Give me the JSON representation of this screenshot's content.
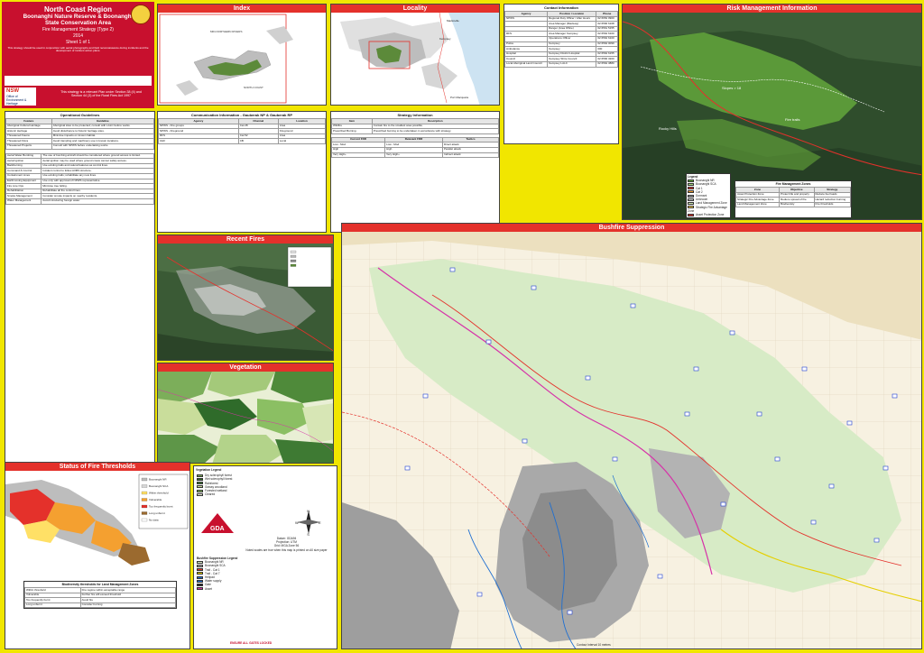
{
  "header": {
    "region": "North Coast Region",
    "reserve_line1": "Boonanghi Nature Reserve & Boonanghi",
    "reserve_line2": "State Conservation Area",
    "strategy": "Fire Management Strategy (Type 2)",
    "year": "2014",
    "sheet": "Sheet 1 of 1",
    "blurb": "This strategy should be used in conjunction with aerial photographs and field reconnaissance during incidents and the development of incident action plans.",
    "strategy_note": "This strategy is a relevant Plan under Section 38 (4) and Section 44 (3) of the Rural Fires Act 1997",
    "nsw_logo": "NSW",
    "nsw_agency": "Office of Environment & Heritage"
  },
  "titles": {
    "index": "Index",
    "locality": "Locality",
    "contact": "Contact Information",
    "risk": "Risk Management Information",
    "recent": "Recent Fires",
    "vegetation": "Vegetation",
    "thresholds": "Status of Fire Thresholds",
    "suppression": "Bushfire Suppression",
    "op_guidelines": "Operational Guidelines",
    "comm": "Communication Information - Gauberak NP & Gauberak RP",
    "strategy_info": "Strategy Information",
    "suppression_legend": "Bushfire Suppression Legend",
    "veg_legend": "Vegetation Legend",
    "risk_legend": "Legend",
    "fire_mgmt_zones": "Fire Management Zones",
    "thresholds_table": "Biodiversity thresholds for Land Management Zones"
  },
  "index_labels": [
    "MID-NORTHERN RIVERS",
    "NORTH COAST"
  ],
  "locality_labels": [
    "Kempsey",
    "Macksville",
    "Port Macquarie"
  ],
  "contact_rows": [
    [
      "NPWS",
      "Regional Duty Officer / After Hours",
      "02 6652 0900"
    ],
    [
      "",
      "Area Manager (Macleay)",
      "02 6566 6168"
    ],
    [
      "",
      "Ranger (Area Office)",
      "02 6561 5155"
    ],
    [
      "RFS",
      "Area Manager Kempsey",
      "02 6562 6100"
    ],
    [
      "",
      "Operations Officer",
      "02 6562 6100"
    ],
    [
      "Police",
      "Kempsey",
      "02 6562 0099"
    ],
    [
      "Ambulance",
      "Kempsey",
      "000"
    ],
    [
      "Hospital",
      "Kempsey District Hospital",
      "02 6562 6155"
    ],
    [
      "Council",
      "Kempsey Shire Council",
      "02 6566 3200"
    ],
    [
      "Local Aboriginal Land Council",
      "Kempsey LALC",
      "02 6562 3880"
    ]
  ],
  "contact_headers": [
    "Agency",
    "Position / Location",
    "Phone"
  ],
  "risk_labels": [
    "Slopes > 18",
    "Rocky Hills",
    "Fire trails"
  ],
  "risk_legend_items": [
    "Boonanghi NR",
    "Boonanghi SCA",
    "Cat 1",
    "Cat 2",
    "Dormant",
    "Unknown",
    "Land Management Zone",
    "Strategic Fire Advantage Zone",
    "Asset Protection Zone"
  ],
  "zones_headers": [
    "Zone",
    "Objective",
    "Strategy"
  ],
  "zones_rows": [
    [
      "Asset Protection Zone",
      "Protect life and property",
      "Reduce fuel loads"
    ],
    [
      "Strategic Fire Advantage Zone",
      "Reduce spread of fire",
      "Hazard reduction burning"
    ],
    [
      "Land Management Zone",
      "Biodiversity",
      "Fire thresholds"
    ]
  ],
  "op_headers": [
    "Feature",
    "Guideline"
  ],
  "op_rows": [
    [
      "Aboriginal Cultural Heritage",
      "Aboriginal sites to be protected; consult with LALC before works."
    ],
    [
      "Historic Heritage",
      "Avoid disturbance to historic heritage sites."
    ],
    [
      "Threatened Fauna",
      "Minimise impacts on known habitat."
    ],
    [
      "Threatened Flora",
      "Avoid trampling and machinery use in known locations."
    ],
    [
      "Threatened Projects",
      "Consult with NPWS before undertaking works."
    ]
  ],
  "general_rows": [
    [
      "Aerial Water Bombing",
      "The use of bombing aircraft should be considered where ground access is limited."
    ],
    [
      "Aerial Ignition",
      "Aerial ignition may be used where ground crews cannot safely access."
    ],
    [
      "Backburning",
      "Use existing trails and natural features as control lines."
    ],
    [
      "Command & Control",
      "Incident control to follow AIIMS structure."
    ],
    [
      "Containment Lines",
      "Use existing trails; rehabilitate any new lines."
    ],
    [
      "Earthmoving Equipment",
      "Use only with approval of NPWS representative."
    ],
    [
      "Fire Line Ops",
      "Minimise tree felling."
    ],
    [
      "Rehabilitation",
      "Rehabilitate all fire control lines."
    ],
    [
      "Smoke Management",
      "Consider smoke impacts on nearby residents."
    ],
    [
      "Water Management",
      "Avoid introducing foreign water."
    ]
  ],
  "comm_headers": [
    "Agency",
    "Channel",
    "Location"
  ],
  "comm_rows": [
    [
      "NPWS - Fire groups",
      "Cat 28",
      "Area"
    ],
    [
      "NPWS - Fireground",
      "",
      "Fireground"
    ],
    [
      "RFS",
      "Cat 52",
      "Area"
    ],
    [
      "UHF",
      "CB",
      "Local"
    ]
  ],
  "strategy_headers": [
    "Item",
    "Description"
  ],
  "strategy_rows": [
    [
      "Wildfire",
      "Contain fire to the smallest area possible."
    ],
    [
      "Prescribed Burning",
      "Prescribed burning to be undertaken in accordance with strategy."
    ]
  ],
  "suppression_table_headers": [
    "Current FDR",
    "Relevant FDR",
    "Tactics"
  ],
  "suppression_table_rows": [
    [
      "Low - Mod",
      "Low - Mod",
      "Direct attack"
    ],
    [
      "High",
      "High",
      "Parallel attack"
    ],
    [
      "Very High+",
      "Very High+",
      "Indirect attack"
    ]
  ],
  "veg_legend_items": [
    "Dry sclerophyll forest",
    "Wet sclerophyll forest",
    "Rainforest",
    "Grassy woodland",
    "Forested wetland",
    "Cleared"
  ],
  "thresholds_legend": [
    "Boonanghi NR",
    "Boonanghi SCA",
    "Within threshold",
    "Vulnerable",
    "Too frequently burnt",
    "Long unburnt",
    "No data"
  ],
  "thresholds_rows": [
    [
      "Within threshold",
      "Fire regime within acceptable range"
    ],
    [
      "Vulnerable",
      "Further fire will exceed threshold"
    ],
    [
      "Too frequently burnt",
      "Avoid fire"
    ],
    [
      "Long unburnt",
      "Consider burning"
    ]
  ],
  "suppression_legend_items": [
    "Boonanghi NR",
    "Boonanghi SCA",
    "Trail - Cat 1",
    "Trail - Cat 7",
    "Helipad",
    "Water supply",
    "Gate",
    "Asset"
  ],
  "datum": {
    "d1": "Datum: GDA94",
    "d2": "Projection: UTM",
    "d3": "Grid: MGA Zone 56",
    "d4": "Noted scales are true when this map is printed on A0 size paper",
    "gda": "GDA",
    "compass_n": "N",
    "compass_s": "S",
    "compass_e": "E",
    "compass_w": "W",
    "verify": "ENSURE ALL GATES LOCKED",
    "contour": "Contour Interval 10 metres"
  },
  "colors": {
    "nsw_red": "#c8102e",
    "title_red": "#e4312b",
    "yellow_bg": "#f1e600",
    "park_green": "#5c8a3a",
    "pink_boundary": "#d633a8"
  }
}
